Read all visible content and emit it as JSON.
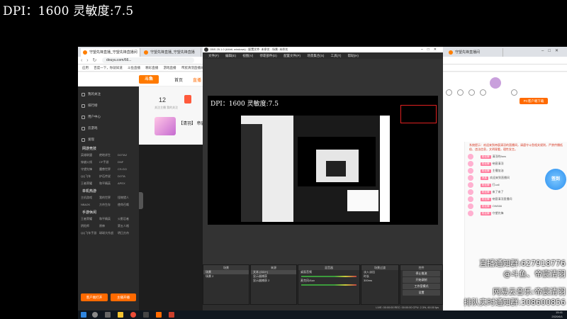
{
  "overlay": {
    "dpi_text": "DPI：1600 灵敏度:7.5",
    "lines": [
      "直播通知群:627918776",
      "@斗鱼、帝宸清羽",
      "网易云音乐:帝宸清羽",
      "排队实时通知群:308600856"
    ]
  },
  "browser": {
    "tabs": [
      {
        "label": "守望先锋直播_守望先锋直播间",
        "active": true
      },
      {
        "label": "守望先锋直播_守望先锋直播",
        "active": false
      },
      {
        "label": "守望先锋直播间",
        "active": false
      }
    ],
    "url": "douyu.com/66...",
    "nav_icons": "‹ › ↻",
    "bookmarks": [
      "应用",
      "百度一下，你就知道",
      "斗鱼直播",
      "精彩直播",
      "游戏直播",
      "帝宸清羽直播间"
    ]
  },
  "douyu": {
    "logo": "斗鱼",
    "nav": [
      "首页",
      "直播"
    ],
    "follow_count": "12",
    "follow_label": "关注主播  我的关注",
    "card_title": "【清羽】 帝宸...",
    "sidebar": {
      "items": [
        "我的关注",
        "排行榜",
        "用户中心",
        "云游戏",
        "发现"
      ],
      "section1": "网游竞技",
      "grid1": [
        "英雄联盟",
        "绝地求生",
        "DOTA2",
        "穿越火线",
        "CF手游",
        "DNF",
        "守望先锋",
        "魔兽世界",
        "CS:GO",
        "QQ飞车",
        "炉石传说",
        "DOTA",
        "王者荣耀",
        "和平精英",
        "APEX"
      ],
      "section2": "单机热游",
      "grid2": [
        "主机游戏",
        "我的世界",
        "怪物猎人",
        "NBA2K",
        "方舟生存",
        "使命召唤"
      ],
      "section3": "手游休闲",
      "grid3": [
        "王者荣耀",
        "和平精英",
        "火影忍者",
        "阴阳师",
        "原神",
        "第五人格",
        "QQ飞车手游",
        "球球大作战",
        "明日方舟"
      ],
      "btn_left": "客户端打开",
      "btn_right": "主播开播"
    }
  },
  "chat": {
    "pc_button": "PC客户端下载",
    "top_icons": [
      "鱼翅",
      "鱼丸",
      "任务",
      "背包",
      "消息"
    ],
    "notice": "系统提示：欢迎来到帝宸清羽的直播间，请遵守斗鱼相关规则，严禁传播低俗、违法信息，文明观看，理性发言。",
    "messages": [
      {
        "tag": "粉丝牌",
        "text": "清羽的fans"
      },
      {
        "tag": "粉丝牌",
        "text": "帝宸清羽"
      },
      {
        "tag": "粉丝牌",
        "text": "主播加油"
      },
      {
        "tag": "贵族",
        "text": "欢迎来到直播间"
      },
      {
        "tag": "粉丝牌",
        "text": "打call"
      },
      {
        "tag": "粉丝牌",
        "text": "来了来了"
      },
      {
        "tag": "粉丝牌",
        "text": "帝宸清羽直播间"
      },
      {
        "tag": "粉丝牌",
        "text": "OW666"
      },
      {
        "tag": "粉丝牌",
        "text": "守望先锋"
      }
    ],
    "badge_text": "签到"
  },
  "obs": {
    "title": "OBS 25.1.0 (64bit, windows) - 配置文件: 未命名 - 场景: 未命名",
    "menu": [
      "文件(F)",
      "编辑(E)",
      "视图(V)",
      "停靠部件(D)",
      "配置文件(P)",
      "场景集合(S)",
      "工具(T)",
      "帮助(H)"
    ],
    "preview_text": "DPI：1600 灵敏度:7.5",
    "docks": {
      "scenes_title": "场景",
      "scenes": [
        "场景",
        "场景 2"
      ],
      "sources_title": "来源",
      "sources": [
        "文本 (GDI+)",
        "显示器捕获",
        "显示器捕获 2"
      ],
      "mixer_title": "混音器",
      "mixer": [
        "桌面音频",
        "麦克风/Aux"
      ],
      "transitions_title": "场景过渡",
      "transition_value": "淡入淡出",
      "duration_label": "时长",
      "duration_value": "300ms",
      "controls_title": "控件",
      "controls": [
        "停止推流",
        "开始录制",
        "工作室模式",
        "设置",
        "退出"
      ]
    },
    "status": "LIVE: 00:00:00   REC: 00:00:00   CPU: 2.3%, 60.00 fps"
  },
  "taskbar": {
    "time": "15:41",
    "date": "2020/6/1"
  }
}
